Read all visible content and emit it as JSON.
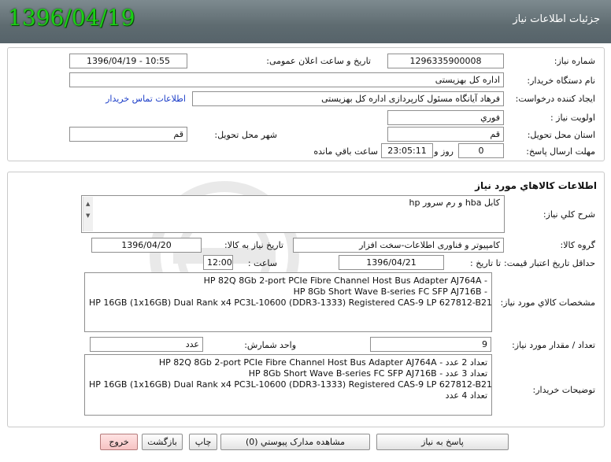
{
  "header": {
    "title": "جزئیات اطلاعات نیاز",
    "date": "1396/04/19"
  },
  "info": {
    "need_number_label": "شماره نیاز:",
    "need_number": "1296335900008",
    "announce_label": "تاریخ و ساعت اعلان عمومی:",
    "announce_value": "1396/04/19 - 10:55",
    "buyer_org_label": "نام دستگاه خریدار:",
    "buyer_org": "اداره کل بهزیستی",
    "creator_label": "ایجاد کننده درخواست:",
    "creator": "فرهاد آیانگاه مسئول کارپردازی اداره کل بهزیستی",
    "contact_link": "اطلاعات تماس خریدار",
    "priority_label": "اولویت نیاز :",
    "priority": "فوري",
    "province_label": "استان محل تحویل:",
    "province": "قم",
    "city_label": "شهر محل تحویل:",
    "city": "قم",
    "deadline_label": "مهلت ارسال پاسخ:",
    "deadline_days": "0",
    "days_word": "روز و",
    "deadline_time": "23:05:11",
    "remaining_word": "ساعت باقي مانده"
  },
  "goods": {
    "section_title": "اطلاعات کالاهاي مورد نیاز",
    "summary_label": "شرح کلي نیاز:",
    "summary": "کابل hba و رم سرور hp",
    "group_label": "گروه کالا:",
    "group": "کامپیوتر و فناوری اطلاعات-سخت افزار",
    "need_date_label": "تاریخ نیاز به کالا:",
    "need_date": "1396/04/20",
    "validity_label": "حداقل تاریخ اعتبار قیمت:",
    "to_date_label": "تا تاریخ :",
    "to_date": "1396/04/21",
    "hour_label": "ساعت :",
    "hour": "12:00",
    "specs_label": "مشخصات کالاي مورد نیاز:",
    "specs": [
      "HP 82Q 8Gb 2-port PCIe Fibre Channel Host Bus Adapter AJ764A -",
      "HP 8Gb Short Wave B-series FC SFP AJ716B -",
      "HP 16GB (1x16GB) Dual Rank x4 PC3L-10600 (DDR3-1333) Registered CAS-9 LP 627812-B21 -"
    ],
    "qty_label": "تعداد / مقدار مورد نیاز:",
    "qty": "9",
    "unit_label": "واحد شمارش:",
    "unit": "عدد",
    "desc_label": "توضیحات خریدار:",
    "desc": [
      "HP 82Q 8Gb 2-port PCIe Fibre Channel Host Bus Adapter AJ764A -  تعداد 2 عدد",
      "HP 8Gb Short Wave B-series FC SFP AJ716B -  تعداد 3 عدد",
      "HP 16GB (1x16GB) Dual Rank x4 PC3L-10600 (DDR3-1333) Registered CAS-9 LP 627812-B21-",
      "تعداد 4 عدد"
    ]
  },
  "buttons": {
    "reply": "پاسخ به نیاز",
    "attachments": "مشاهده مدارک پیوستي (0)",
    "print": "چاپ",
    "back": "بازگشت",
    "exit": "خروج"
  }
}
